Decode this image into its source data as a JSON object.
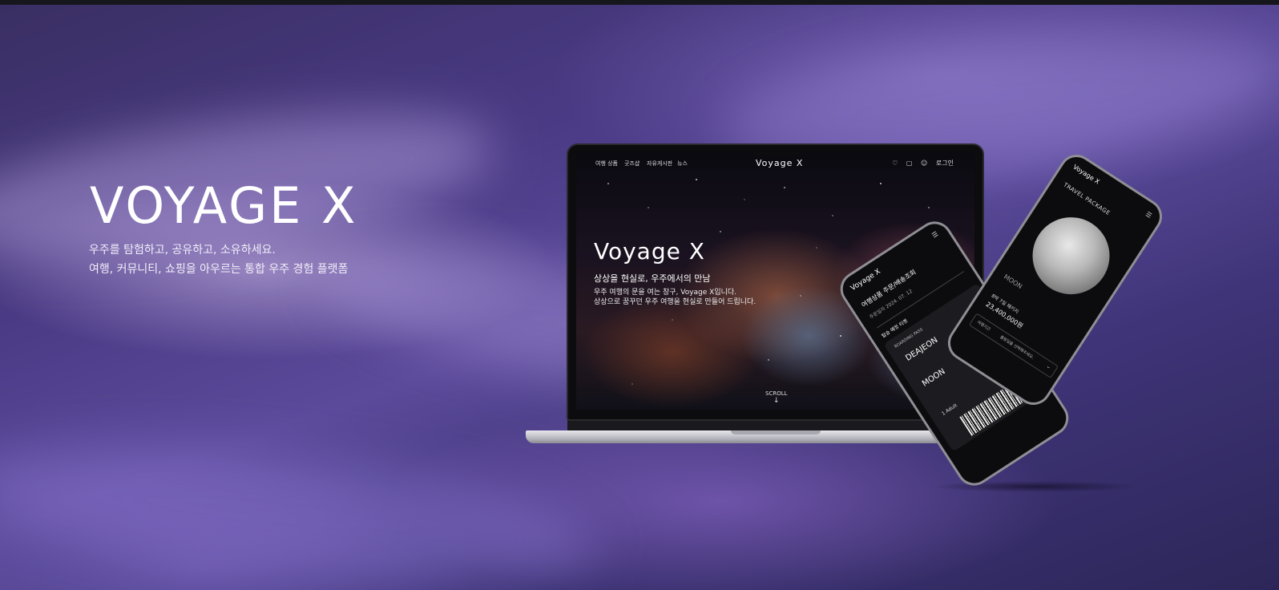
{
  "hero": {
    "title": "VOYAGE X",
    "subtitle_line1": "우주를 탐험하고, 공유하고, 소유하세요.",
    "subtitle_line2": "여행, 커뮤니티, 쇼핑을 아우르는 통합 우주 경험 플랫폼"
  },
  "laptop": {
    "nav": [
      "여행 상품",
      "굿즈샵",
      "자유게시판",
      "뉴스"
    ],
    "logo": "Voyage X",
    "login": "로그인",
    "title": "Voyage X",
    "subtitle": "상상을 현실로, 우주에서의 만남",
    "desc_line1": "우주 여행의 문을 여는 창구, Voyage X입니다.",
    "desc_line2": "상상으로 꿈꾸던 우주 여행을 현실로 만들어 드립니다.",
    "scroll": "SCROLL"
  },
  "phone1": {
    "header": "Voyage X",
    "title": "여행상품 주문/배송조회",
    "date": "주문일자 2024. 07. 12",
    "status": "탑승 예정 티켓",
    "pass": "BOARDING PASS",
    "from": "DEAJEON",
    "to": "MOON",
    "passenger": "1 Adult"
  },
  "phone2": {
    "header": "Voyage X",
    "section": "TRAVEL PACKAGE",
    "product": "MOON",
    "duration": "8박 7일 패키지",
    "price": "23,400,000원",
    "option_label": "여행기간",
    "option_value": "출발일을 선택해주세요."
  }
}
